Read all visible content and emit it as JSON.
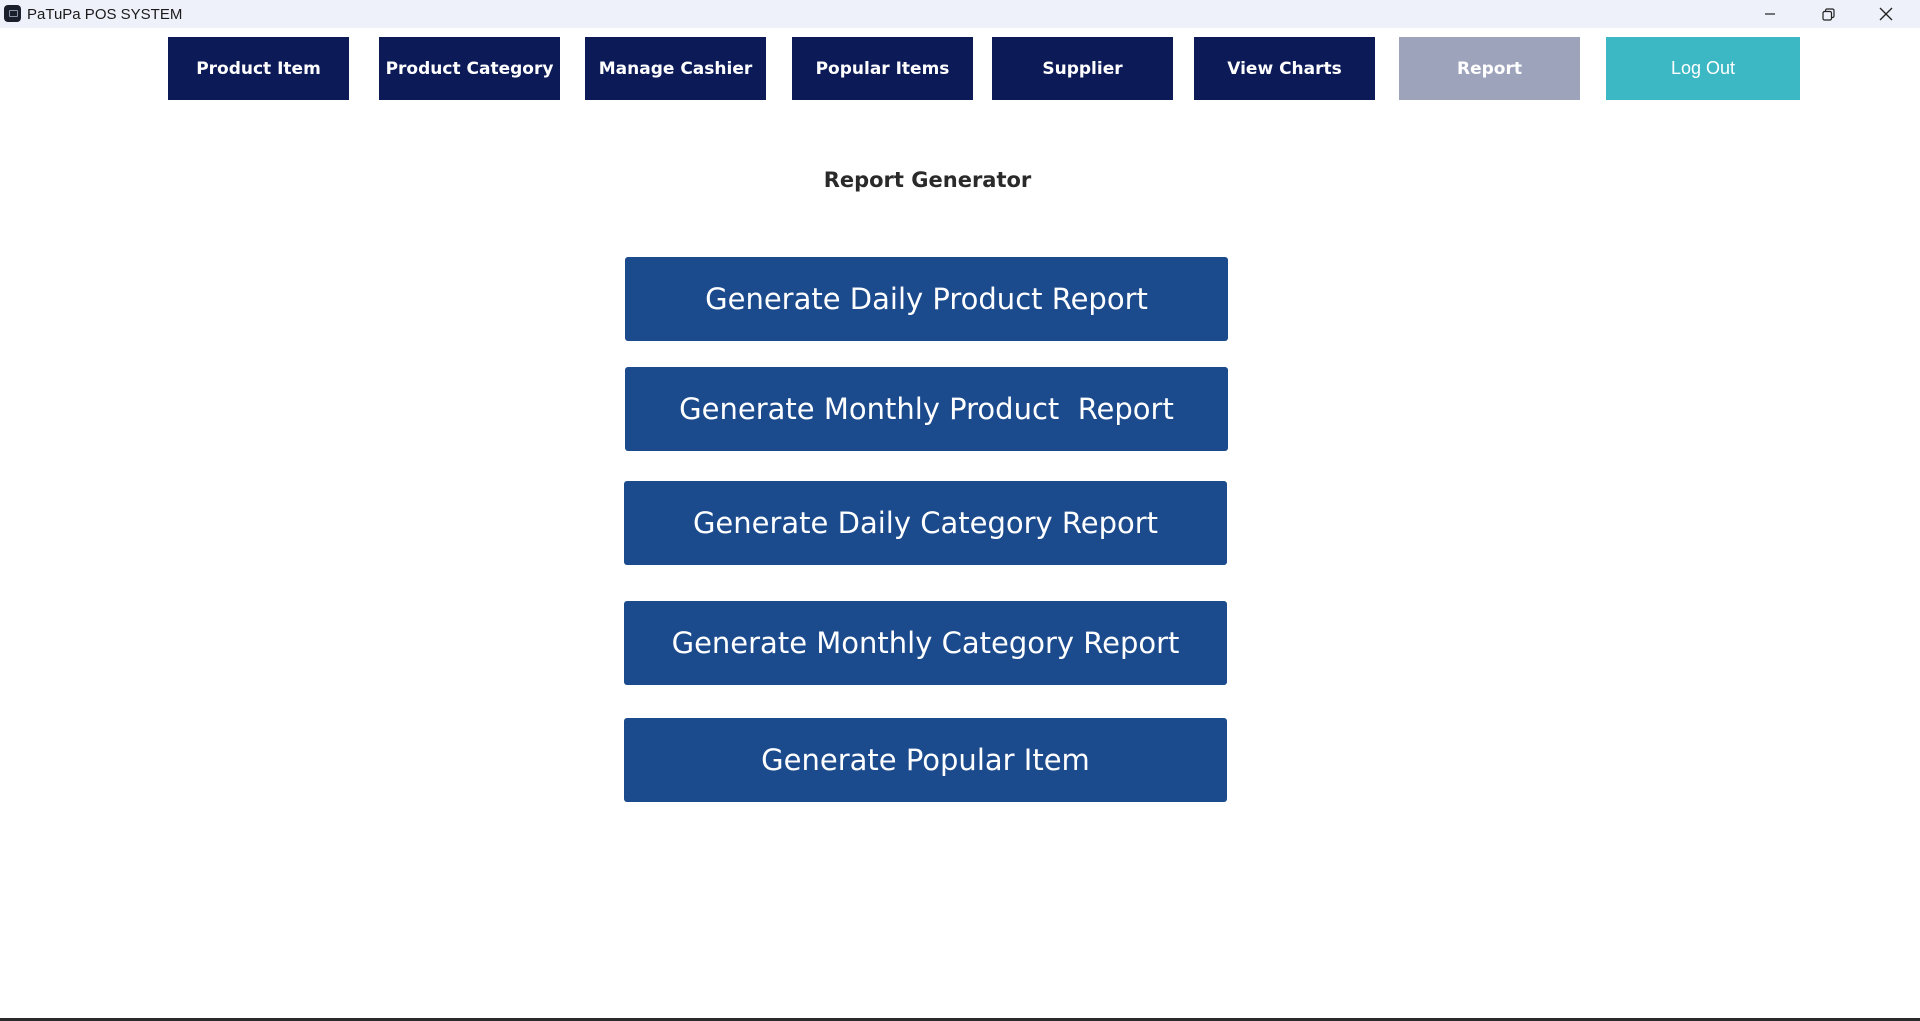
{
  "window": {
    "title": "PaTuPa POS SYSTEM",
    "controls": [
      "minimize-icon",
      "restore-icon",
      "close-icon"
    ]
  },
  "nav": {
    "product_item": "Product Item",
    "product_category": "Product Category",
    "manage_cashier": "Manage Cashier",
    "popular_items": "Popular Items",
    "supplier": "Supplier",
    "view_charts": "View Charts",
    "report": "Report",
    "log_out": "Log Out"
  },
  "page": {
    "heading": "Report Generator"
  },
  "actions": {
    "daily_product": "Generate Daily Product Report",
    "monthly_product": "Generate Monthly Product  Report",
    "daily_category": "Generate Daily Category Report",
    "monthly_category": "Generate Monthly Category Report",
    "popular_item": "Generate Popular Item"
  },
  "colors": {
    "nav_dark": "#0c1a57",
    "nav_active": "#9ea3bc",
    "logout": "#3cb8c4",
    "action_button": "#1b4a8d"
  }
}
